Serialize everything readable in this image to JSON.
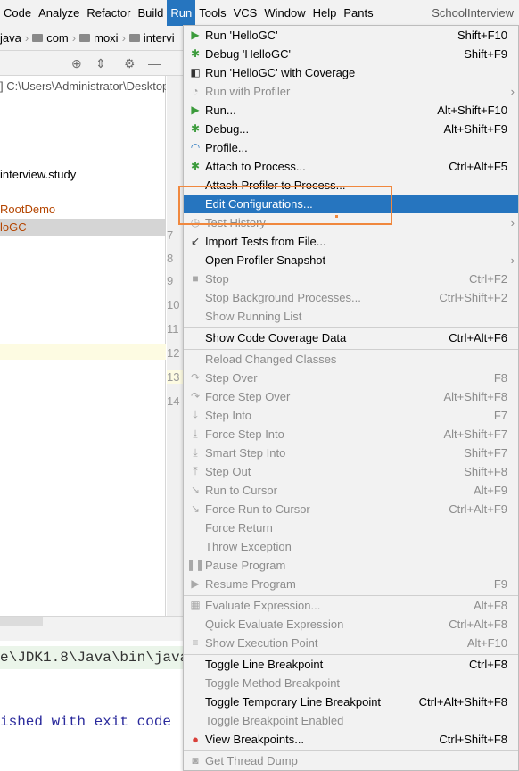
{
  "menubar": {
    "items": [
      "Code",
      "Analyze",
      "Refactor",
      "Build",
      "Run",
      "Tools",
      "VCS",
      "Window",
      "Help",
      "Pants"
    ],
    "active": "Run",
    "project_title": "SchoolInterview"
  },
  "breadcrumb": [
    "java",
    "com",
    "moxi",
    "intervi"
  ],
  "project_tree": [
    {
      "text": "] C:\\Users\\Administrator\\Desktop",
      "color": "#555555"
    },
    {
      "text": "interview.study",
      "color": "#000000"
    },
    {
      "text": "RootDemo",
      "color": "#b44500"
    },
    {
      "text": "loGC",
      "color": "#b44500"
    }
  ],
  "gutter_lines": [
    "7",
    "8",
    "9",
    "10",
    "11",
    "12",
    "13",
    "14"
  ],
  "console": {
    "line1": "e\\JDK1.8\\Java\\bin\\java",
    "line2": "ished with exit code"
  },
  "run_menu": {
    "items": [
      {
        "label": "Run 'HelloGC'",
        "shortcut": "Shift+F10",
        "icon": "run-icon"
      },
      {
        "label": "Debug 'HelloGC'",
        "shortcut": "Shift+F9",
        "icon": "debug-icon"
      },
      {
        "label": "Run 'HelloGC' with Coverage",
        "shortcut": "",
        "icon": "coverage-icon"
      },
      {
        "label": "Run with Profiler",
        "shortcut": "",
        "icon": "profiler-icon",
        "disabled": true,
        "submenu": true
      },
      {
        "label": "Run...",
        "shortcut": "Alt+Shift+F10",
        "icon": "run-icon"
      },
      {
        "label": "Debug...",
        "shortcut": "Alt+Shift+F9",
        "icon": "debug-icon"
      },
      {
        "label": "Profile...",
        "shortcut": "",
        "icon": "profile-icon"
      },
      {
        "label": "Attach to Process...",
        "shortcut": "Ctrl+Alt+F5",
        "icon": "attach-icon"
      },
      {
        "label": "Attach Profiler to Process...",
        "shortcut": "",
        "icon": ""
      },
      {
        "label": "Edit Configurations...",
        "shortcut": "",
        "icon": "",
        "highlighted": true
      },
      {
        "label": "Test History",
        "shortcut": "",
        "icon": "history-icon",
        "disabled": true,
        "submenu": true
      },
      {
        "label": "Import Tests from File...",
        "shortcut": "",
        "icon": "import-icon"
      },
      {
        "label": "Open Profiler Snapshot",
        "shortcut": "",
        "icon": "",
        "submenu": true
      },
      {
        "label": "Stop",
        "shortcut": "Ctrl+F2",
        "icon": "stop-icon",
        "disabled": true
      },
      {
        "label": "Stop Background Processes...",
        "shortcut": "Ctrl+Shift+F2",
        "icon": "",
        "disabled": true
      },
      {
        "label": "Show Running List",
        "shortcut": "",
        "icon": "",
        "disabled": true
      },
      {
        "label": "Show Code Coverage Data",
        "shortcut": "Ctrl+Alt+F6",
        "icon": "",
        "separator_before": true
      },
      {
        "label": "Reload Changed Classes",
        "shortcut": "",
        "icon": "",
        "disabled": true,
        "separator_before": true
      },
      {
        "label": "Step Over",
        "shortcut": "F8",
        "icon": "step-over-icon",
        "disabled": true
      },
      {
        "label": "Force Step Over",
        "shortcut": "Alt+Shift+F8",
        "icon": "force-step-over-icon",
        "disabled": true
      },
      {
        "label": "Step Into",
        "shortcut": "F7",
        "icon": "step-into-icon",
        "disabled": true
      },
      {
        "label": "Force Step Into",
        "shortcut": "Alt+Shift+F7",
        "icon": "force-step-into-icon",
        "disabled": true
      },
      {
        "label": "Smart Step Into",
        "shortcut": "Shift+F7",
        "icon": "smart-step-into-icon",
        "disabled": true
      },
      {
        "label": "Step Out",
        "shortcut": "Shift+F8",
        "icon": "step-out-icon",
        "disabled": true
      },
      {
        "label": "Run to Cursor",
        "shortcut": "Alt+F9",
        "icon": "run-to-cursor-icon",
        "disabled": true
      },
      {
        "label": "Force Run to Cursor",
        "shortcut": "Ctrl+Alt+F9",
        "icon": "force-run-to-cursor-icon",
        "disabled": true
      },
      {
        "label": "Force Return",
        "shortcut": "",
        "icon": "",
        "disabled": true
      },
      {
        "label": "Throw Exception",
        "shortcut": "",
        "icon": "",
        "disabled": true
      },
      {
        "label": "Pause Program",
        "shortcut": "",
        "icon": "pause-icon",
        "disabled": true
      },
      {
        "label": "Resume Program",
        "shortcut": "F9",
        "icon": "resume-icon",
        "disabled": true
      },
      {
        "label": "Evaluate Expression...",
        "shortcut": "Alt+F8",
        "icon": "calculator-icon",
        "disabled": true,
        "separator_before": true
      },
      {
        "label": "Quick Evaluate Expression",
        "shortcut": "Ctrl+Alt+F8",
        "icon": "",
        "disabled": true
      },
      {
        "label": "Show Execution Point",
        "shortcut": "Alt+F10",
        "icon": "execution-point-icon",
        "disabled": true
      },
      {
        "label": "Toggle Line Breakpoint",
        "shortcut": "Ctrl+F8",
        "icon": "",
        "separator_before": true
      },
      {
        "label": "Toggle Method Breakpoint",
        "shortcut": "",
        "icon": "",
        "disabled": true
      },
      {
        "label": "Toggle Temporary Line Breakpoint",
        "shortcut": "Ctrl+Alt+Shift+F8",
        "icon": ""
      },
      {
        "label": "Toggle Breakpoint Enabled",
        "shortcut": "",
        "icon": "",
        "disabled": true
      },
      {
        "label": "View Breakpoints...",
        "shortcut": "Ctrl+Shift+F8",
        "icon": "breakpoints-icon"
      },
      {
        "label": "Get Thread Dump",
        "shortcut": "",
        "icon": "camera-icon",
        "disabled": true,
        "separator_before": true
      }
    ]
  },
  "colors": {
    "accent": "#2675bf",
    "annotation": "#f0883e",
    "menu_bg": "#f2f2f2",
    "run_green": "#3b9b3b"
  }
}
